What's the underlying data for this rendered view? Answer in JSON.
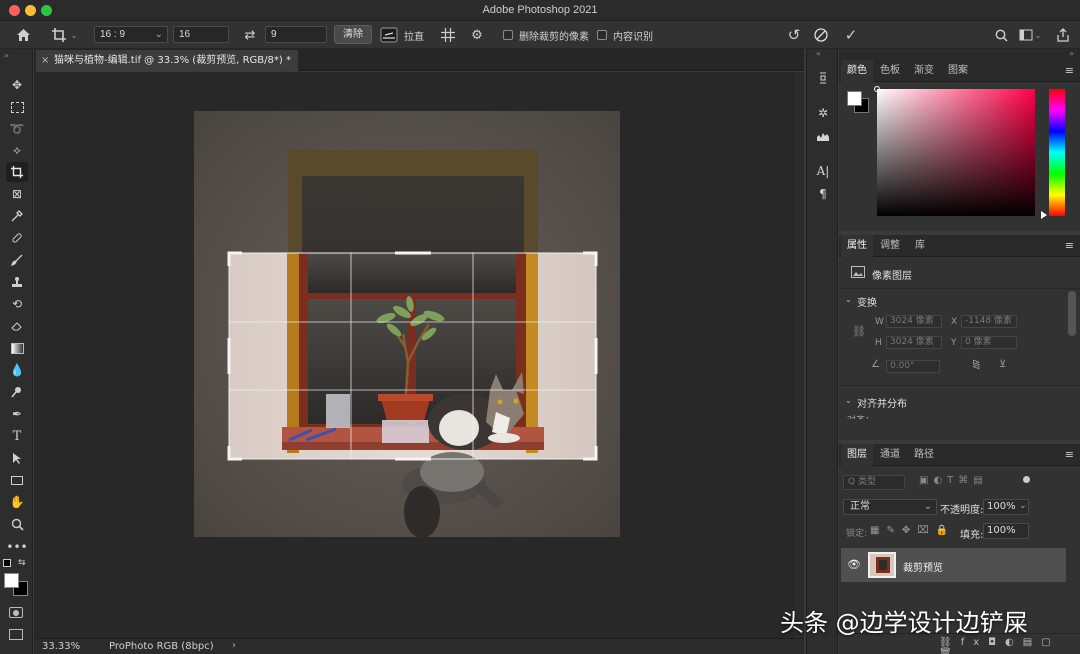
{
  "window": {
    "title": "Adobe Photoshop 2021"
  },
  "options": {
    "ratio_value": "16 : 9",
    "width_value": "16",
    "height_value": "9",
    "clear_label": "清除",
    "straighten_label": "拉直",
    "delete_cropped_label": "删除裁剪的像素",
    "content_aware_label": "内容识别"
  },
  "document": {
    "tab_title": "猫咪与植物-编辑.tif @ 33.3% (裁剪预览, RGB/8*) *",
    "tab_close": "×",
    "zoom": "33.33%",
    "color_profile": "ProPhoto RGB (8bpc)",
    "status_arrow": "›"
  },
  "color_panel": {
    "tabs": [
      "颜色",
      "色板",
      "渐变",
      "图案"
    ],
    "accent_colors": {
      "hue_top": "#ff0040",
      "field_mid": "#e0005a"
    }
  },
  "properties_panel": {
    "tabs": [
      "属性",
      "调整",
      "库"
    ],
    "layer_type": "像素图层",
    "transform_heading": "变换",
    "w_label": "W",
    "w_value": "3024 像素",
    "x_label": "X",
    "x_value": "-1148 像素",
    "h_label": "H",
    "h_value": "3024 像素",
    "y_label": "Y",
    "y_value": "0 像素",
    "angle_value": "0.00°",
    "align_heading": "对齐并分布",
    "align_sub": "对齐："
  },
  "layers_panel": {
    "tabs": [
      "图层",
      "通道",
      "路径"
    ],
    "filter_label": "Q 类型",
    "blend_mode": "正常",
    "opacity_label": "不透明度:",
    "opacity_value": "100%",
    "lock_label": "锁定:",
    "fill_label": "填充:",
    "fill_value": "100%",
    "layers": [
      {
        "name": "裁剪预览",
        "visible": true
      }
    ]
  },
  "watermark": "头条 @边学设计边铲屎"
}
